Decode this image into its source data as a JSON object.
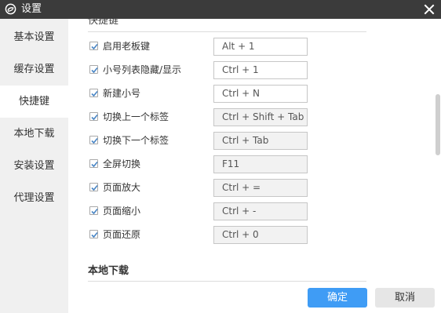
{
  "window": {
    "title": "设置",
    "logo_icon": "swirl-logo-icon",
    "close_icon": "close-icon"
  },
  "sidebar": {
    "items": [
      {
        "label": "基本设置",
        "active": false
      },
      {
        "label": "缓存设置",
        "active": false
      },
      {
        "label": "快捷键",
        "active": true
      },
      {
        "label": "本地下载",
        "active": false
      },
      {
        "label": "安装设置",
        "active": false
      },
      {
        "label": "代理设置",
        "active": false
      }
    ]
  },
  "shortcuts": {
    "section_title": "快捷键",
    "rows": [
      {
        "label": "启用老板键",
        "value": "Alt + 1",
        "checked": true,
        "enabled": true
      },
      {
        "label": "小号列表隐藏/显示",
        "value": "Ctrl + 1",
        "checked": true,
        "enabled": true
      },
      {
        "label": "新建小号",
        "value": "Ctrl + N",
        "checked": true,
        "enabled": true
      },
      {
        "label": "切换上一个标签",
        "value": "Ctrl + Shift + Tab",
        "checked": true,
        "enabled": false
      },
      {
        "label": "切换下一个标签",
        "value": "Ctrl + Tab",
        "checked": true,
        "enabled": false
      },
      {
        "label": "全屏切换",
        "value": "F11",
        "checked": true,
        "enabled": false
      },
      {
        "label": "页面放大",
        "value": "Ctrl + =",
        "checked": true,
        "enabled": false
      },
      {
        "label": "页面缩小",
        "value": "Ctrl + -",
        "checked": true,
        "enabled": false
      },
      {
        "label": "页面还原",
        "value": "Ctrl + 0",
        "checked": true,
        "enabled": false
      }
    ]
  },
  "local_download": {
    "section_title": "本地下载"
  },
  "buttons": {
    "ok": "确定",
    "cancel": "取消"
  },
  "colors": {
    "titlebar": "#3b3b3b",
    "accent": "#3f9cf5",
    "checkmark": "#4a86c5"
  }
}
